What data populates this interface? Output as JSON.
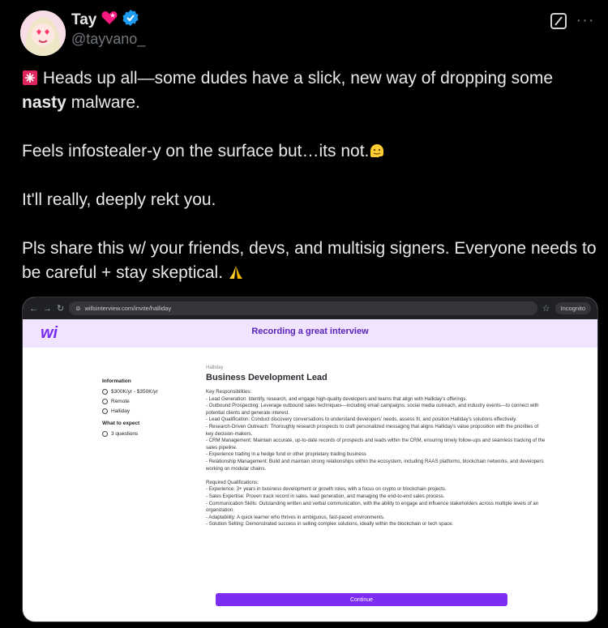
{
  "post": {
    "display_name": "Tay",
    "handle": "@tayvano_",
    "paragraphs": [
      {
        "before": " Heads up all—some dudes have a slick, new way of dropping some ",
        "bold": "nasty",
        "after": " malware."
      },
      {
        "before": "Feels infostealer-y on the surface but…its not.",
        "bold": "",
        "after": ""
      },
      {
        "before": "It'll really, deeply rekt you.",
        "bold": "",
        "after": ""
      },
      {
        "before": "Pls share this w/ your friends, devs, and multisig signers. Everyone needs to be careful + stay skeptical. ",
        "bold": "",
        "after": ""
      }
    ],
    "colors": {
      "verified": "#1d9bf0",
      "heart": "#f91880",
      "siren": "#e0245e"
    }
  },
  "screenshot": {
    "url": "willsinterview.com/invite/halliday",
    "incognito_label": "Incognito",
    "site_logo": "wi",
    "header_title": "Recording a great interview",
    "info": {
      "heading": "Information",
      "salary": "$300K/yr - $350K/yr",
      "location": "Remote",
      "company": "Halliday",
      "expect_heading": "What to expect",
      "questions": "3 questions"
    },
    "job": {
      "company": "Halliday",
      "title": "Business Development Lead",
      "lines": [
        "Key Responsibilities:",
        "- Lead Generation: Identify, research, and engage high-quality developers and teams that align with Halliday's offerings.",
        "- Outbound Prospecting: Leverage outbound sales techniques—including email campaigns, social media outreach, and industry events—to connect with potential clients and generate interest.",
        "- Lead Qualification: Conduct discovery conversations to understand developers' needs, assess fit, and position Halliday's solutions effectively.",
        "- Research-Driven Outreach: Thoroughly research prospects to craft personalized messaging that aligns Halliday's value proposition with the priorities of key decision-makers.",
        "- CRM Management: Maintain accurate, up-to-date records of prospects and leads within the CRM, ensuring timely follow-ups and seamless tracking of the sales pipeline.",
        "- Experience trading in a hedge fund or other proprietary trading business",
        "- Relationship Management: Build and maintain strong relationships within the ecosystem, including RAAS platforms, blockchain networks, and developers working on modular chains.",
        "",
        "Required Qualifications:",
        "- Experience: 3+ years in business development or growth roles, with a focus on crypto or blockchain projects.",
        "- Sales Expertise: Proven track record in sales, lead generation, and managing the end-to-end sales process.",
        "- Communication Skills: Outstanding written and verbal communication, with the ability to engage and influence stakeholders across multiple levels of an organization.",
        "- Adaptability: A quick learner who thrives in ambiguous, fast-paced environments.",
        "- Solution Selling: Demonstrated success in selling complex solutions, ideally within the blockchain or tech space."
      ]
    },
    "continue_label": "Continue",
    "accent": "#7c2df0"
  }
}
